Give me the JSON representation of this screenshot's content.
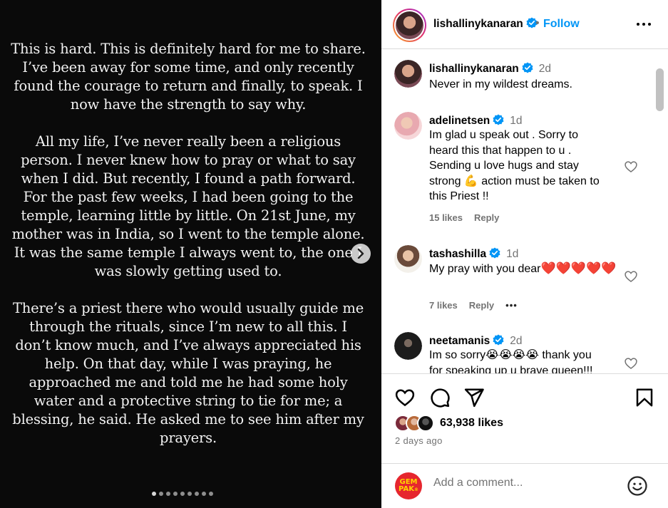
{
  "post": {
    "paragraphs": [
      "This is hard. This is definitely hard for me to share. I’ve been away for some time, and only recently found the courage to return and finally, to speak. I now have the strength to say why.",
      "All my life, I’ve never really been a religious person. I never knew how to pray or what to say when I did. But recently, I found a path forward. For the past few weeks, I had been going to the temple, learning little by little. On 21st June, my mother was in India, so I went to the temple alone. It was the same temple I always went to, the one I was slowly getting used to.",
      "There’s a priest there who would usually guide me through the rituals, since I’m new to all this. I don’t know much, and I’ve always appreciated his help. On that day, while I was praying, he approached me and told me he had some holy water and a protective string to tie for me; a blessing, he said. He asked me to see him after my prayers."
    ],
    "carousel_dots": 9,
    "active_dot": 0
  },
  "header": {
    "username": "lishallinykanaran",
    "separator": "•",
    "follow_label": "Follow"
  },
  "comments": [
    {
      "username": "lishallinykanaran",
      "time": "2d",
      "text": "Never in my wildest dreams."
    },
    {
      "username": "adelinetsen",
      "time": "1d",
      "text_lines": [
        "Im glad u speak out . Sorry to",
        "heard this that happen to u .",
        "Sending u love hugs and stay",
        "strong 💪 action must be taken to",
        "this Priest !!"
      ],
      "likes": "15 likes",
      "reply": "Reply"
    },
    {
      "username": "tashashilla",
      "time": "1d",
      "text": "My pray with you dear",
      "hearts": "❤️❤️❤️❤️❤️",
      "likes": "7 likes",
      "reply": "Reply",
      "more": "•••"
    },
    {
      "username": "neetamanis",
      "time": "2d",
      "text_line1": "Im so sorry😭😭😭😭 thank you",
      "text_line2": "for speaking up u brave queen!!!"
    }
  ],
  "engagement": {
    "likes": "63,938 likes",
    "date": "2 days ago"
  },
  "composer": {
    "avatar_text_1": "GEM",
    "avatar_text_2": "PAK",
    "avatar_text_3": "®",
    "placeholder": "Add a comment..."
  },
  "colors": {
    "follow": "#0095f6",
    "verified": "#0095f6",
    "heart": "#e0241b",
    "gempak": "#e6262e"
  }
}
